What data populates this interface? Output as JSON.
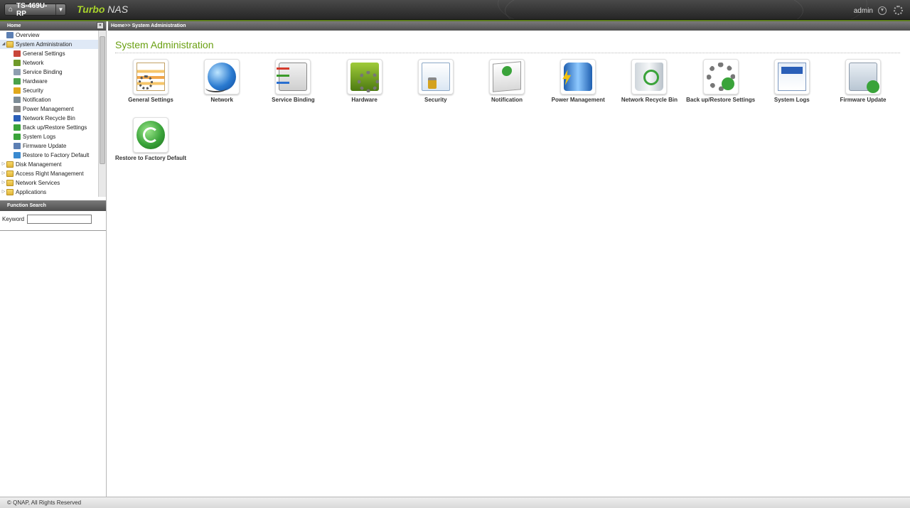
{
  "topbar": {
    "model": "TS-469U-RP",
    "brand_a": "Turbo",
    "brand_b": "NAS",
    "user": "admin"
  },
  "sidebar": {
    "header": "Home",
    "tree": [
      {
        "label": "Overview",
        "level": 0,
        "icon": "overview-icon"
      },
      {
        "label": "System Administration",
        "level": 0,
        "icon": "folder-icon",
        "selected": true,
        "expanded": true
      },
      {
        "label": "General Settings",
        "level": 1,
        "icon": "general-settings-icon"
      },
      {
        "label": "Network",
        "level": 1,
        "icon": "network-icon"
      },
      {
        "label": "Service Binding",
        "level": 1,
        "icon": "service-binding-icon"
      },
      {
        "label": "Hardware",
        "level": 1,
        "icon": "hardware-icon"
      },
      {
        "label": "Security",
        "level": 1,
        "icon": "security-icon"
      },
      {
        "label": "Notification",
        "level": 1,
        "icon": "notification-icon"
      },
      {
        "label": "Power Management",
        "level": 1,
        "icon": "power-icon"
      },
      {
        "label": "Network Recycle Bin",
        "level": 1,
        "icon": "recycle-bin-icon"
      },
      {
        "label": "Back up/Restore Settings",
        "level": 1,
        "icon": "backup-icon"
      },
      {
        "label": "System Logs",
        "level": 1,
        "icon": "logs-icon"
      },
      {
        "label": "Firmware Update",
        "level": 1,
        "icon": "firmware-icon"
      },
      {
        "label": "Restore to Factory Default",
        "level": 1,
        "icon": "factory-icon"
      },
      {
        "label": "Disk Management",
        "level": 0,
        "icon": "folder-icon"
      },
      {
        "label": "Access Right Management",
        "level": 0,
        "icon": "folder-icon"
      },
      {
        "label": "Network Services",
        "level": 0,
        "icon": "folder-icon"
      },
      {
        "label": "Applications",
        "level": 0,
        "icon": "folder-icon"
      }
    ],
    "search": {
      "header": "Function Search",
      "keyword_label": "Keyword",
      "keyword_value": ""
    }
  },
  "main": {
    "breadcrumb": "Home>> System Administration",
    "title": "System Administration",
    "tiles": [
      {
        "label": "General Settings",
        "art": "general"
      },
      {
        "label": "Network",
        "art": "network"
      },
      {
        "label": "Service Binding",
        "art": "binding"
      },
      {
        "label": "Hardware",
        "art": "hardware"
      },
      {
        "label": "Security",
        "art": "security"
      },
      {
        "label": "Notification",
        "art": "notification"
      },
      {
        "label": "Power Management",
        "art": "power"
      },
      {
        "label": "Network Recycle Bin",
        "art": "recycle"
      },
      {
        "label": "Back up/Restore Settings",
        "art": "backup"
      },
      {
        "label": "System Logs",
        "art": "logs"
      },
      {
        "label": "Firmware Update",
        "art": "firmware"
      },
      {
        "label": "Restore to Factory Default",
        "art": "factory"
      }
    ]
  },
  "footer": {
    "copyright": "© QNAP, All Rights Reserved"
  },
  "colors": {
    "accent_green": "#6aa012",
    "header_dark": "#262626",
    "selection": "#dfe9f6"
  }
}
